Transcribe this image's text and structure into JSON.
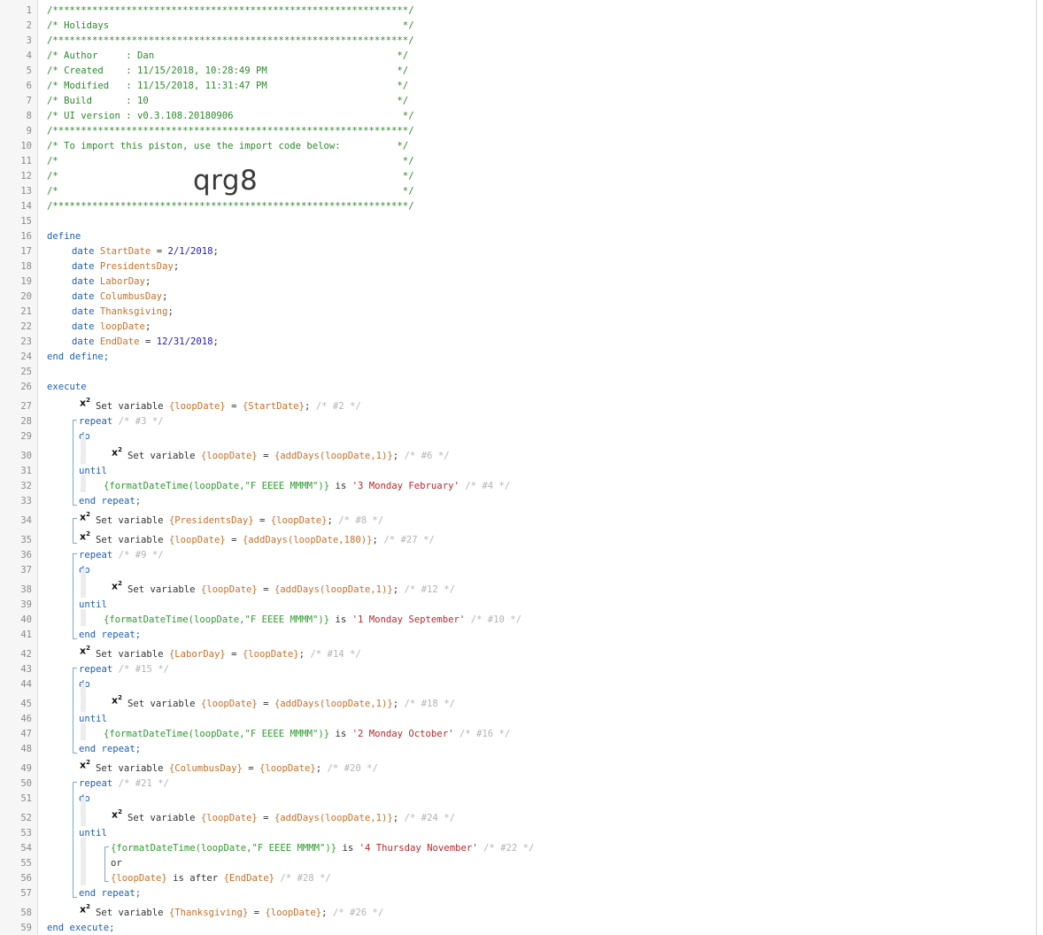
{
  "gutter": {
    "line_numbers": [
      "1",
      "2",
      "3",
      "4",
      "5",
      "6",
      "7",
      "8",
      "9",
      "10",
      "11",
      "12",
      "13",
      "14",
      "15",
      "16",
      "17",
      "18",
      "19",
      "20",
      "21",
      "22",
      "23",
      "24",
      "25",
      "26",
      "27",
      "28",
      "29",
      "30",
      "31",
      "32",
      "33",
      "34",
      "35",
      "36",
      "37",
      "38",
      "39",
      "40",
      "41",
      "42",
      "43",
      "44",
      "45",
      "46",
      "47",
      "48",
      "49",
      "50",
      "51",
      "52",
      "53",
      "54",
      "55",
      "56",
      "57",
      "58",
      "59"
    ]
  },
  "header": {
    "border": "/***************************************************************/",
    "title_line": "/* Holidays                                                    */",
    "author_line": "/* Author     : Dan                                           */",
    "created_line": "/* Created    : 11/15/2018, 10:28:49 PM                       */",
    "modified_line": "/* Modified   : 11/15/2018, 11:31:47 PM                       */",
    "build_line": "/* Build      : 10                                            */",
    "ui_version_line": "/* UI version : v0.3.108.20180906                              */",
    "import_line": "/* To import this piston, use the import code below:          */",
    "blank_line": "/*                                                             */",
    "import_code": "qrg8"
  },
  "define": {
    "start": "define",
    "end": "end define;",
    "vars": [
      {
        "type": "date",
        "name": "StartDate",
        "assign": " = ",
        "value": "2/1/2018",
        "semi": ";"
      },
      {
        "type": "date",
        "name": "PresidentsDay",
        "assign": "",
        "value": "",
        "semi": ";"
      },
      {
        "type": "date",
        "name": "LaborDay",
        "assign": "",
        "value": "",
        "semi": ";"
      },
      {
        "type": "date",
        "name": "ColumbusDay",
        "assign": "",
        "value": "",
        "semi": ";"
      },
      {
        "type": "date",
        "name": "Thanksgiving",
        "assign": "",
        "value": "",
        "semi": ";"
      },
      {
        "type": "date",
        "name": "loopDate",
        "assign": "",
        "value": "",
        "semi": ";"
      },
      {
        "type": "date",
        "name": "EndDate",
        "assign": " = ",
        "value": "12/31/2018",
        "semi": ";"
      }
    ]
  },
  "execute": {
    "start": "execute",
    "end": "end execute;",
    "lines": {
      "l27": {
        "pre": "Set variable ",
        "var": "{loopDate}",
        "mid": " = ",
        "val": "{StartDate}",
        "post": "; ",
        "cmt": "/* #2 */"
      },
      "l28": {
        "kw": "repeat",
        "cmt": " /* #3 */"
      },
      "l29": {
        "kw": "do"
      },
      "l30": {
        "pre": "Set variable ",
        "var": "{loopDate}",
        "mid": " = ",
        "val": "{addDays(loopDate,1)}",
        "post": "; ",
        "cmt": "/* #6 */"
      },
      "l31": {
        "kw": "until"
      },
      "l32": {
        "expr": "{formatDateTime(loopDate,\"F EEEE MMMM\")}",
        "op": " is ",
        "str": "'3 Monday February'",
        "cmt": " /* #4 */"
      },
      "l33": {
        "kw": "end repeat;"
      },
      "l34": {
        "pre": "Set variable ",
        "var": "{PresidentsDay}",
        "mid": " = ",
        "val": "{loopDate}",
        "post": "; ",
        "cmt": "/* #8 */"
      },
      "l35": {
        "pre": "Set variable ",
        "var": "{loopDate}",
        "mid": " = ",
        "val": "{addDays(loopDate,180)}",
        "post": "; ",
        "cmt": "/* #27 */"
      },
      "l36": {
        "kw": "repeat",
        "cmt": " /* #9 */"
      },
      "l37": {
        "kw": "do"
      },
      "l38": {
        "pre": "Set variable ",
        "var": "{loopDate}",
        "mid": " = ",
        "val": "{addDays(loopDate,1)}",
        "post": "; ",
        "cmt": "/* #12 */"
      },
      "l39": {
        "kw": "until"
      },
      "l40": {
        "expr": "{formatDateTime(loopDate,\"F EEEE MMMM\")}",
        "op": " is ",
        "str": "'1 Monday September'",
        "cmt": " /* #10 */"
      },
      "l41": {
        "kw": "end repeat;"
      },
      "l42": {
        "pre": "Set variable ",
        "var": "{LaborDay}",
        "mid": " = ",
        "val": "{loopDate}",
        "post": "; ",
        "cmt": "/* #14 */"
      },
      "l43": {
        "kw": "repeat",
        "cmt": " /* #15 */"
      },
      "l44": {
        "kw": "do"
      },
      "l45": {
        "pre": "Set variable ",
        "var": "{loopDate}",
        "mid": " = ",
        "val": "{addDays(loopDate,1)}",
        "post": "; ",
        "cmt": "/* #18 */"
      },
      "l46": {
        "kw": "until"
      },
      "l47": {
        "expr": "{formatDateTime(loopDate,\"F EEEE MMMM\")}",
        "op": " is ",
        "str": "'2 Monday October'",
        "cmt": " /* #16 */"
      },
      "l48": {
        "kw": "end repeat;"
      },
      "l49": {
        "pre": "Set variable ",
        "var": "{ColumbusDay}",
        "mid": " = ",
        "val": "{loopDate}",
        "post": "; ",
        "cmt": "/* #20 */"
      },
      "l50": {
        "kw": "repeat",
        "cmt": " /* #21 */"
      },
      "l51": {
        "kw": "do"
      },
      "l52": {
        "pre": "Set variable ",
        "var": "{loopDate}",
        "mid": " = ",
        "val": "{addDays(loopDate,1)}",
        "post": "; ",
        "cmt": "/* #24 */"
      },
      "l53": {
        "kw": "until"
      },
      "l54": {
        "expr": "{formatDateTime(loopDate,\"F EEEE MMMM\")}",
        "op": " is ",
        "str": "'4 Thursday November'",
        "cmt": " /* #22 */"
      },
      "l55": {
        "plain": "or"
      },
      "l56": {
        "var": "{loopDate}",
        "op": " is after ",
        "var2": "{EndDate}",
        "cmt": " /* #28 */"
      },
      "l57": {
        "kw": "end repeat;"
      },
      "l58": {
        "pre": "Set variable ",
        "var": "{Thanksgiving}",
        "mid": " = ",
        "val": "{loopDate}",
        "post": "; ",
        "cmt": "/* #26 */"
      }
    }
  },
  "icons": {
    "set_variable": "x2-icon",
    "x_label": "x",
    "x_sup": "2"
  }
}
